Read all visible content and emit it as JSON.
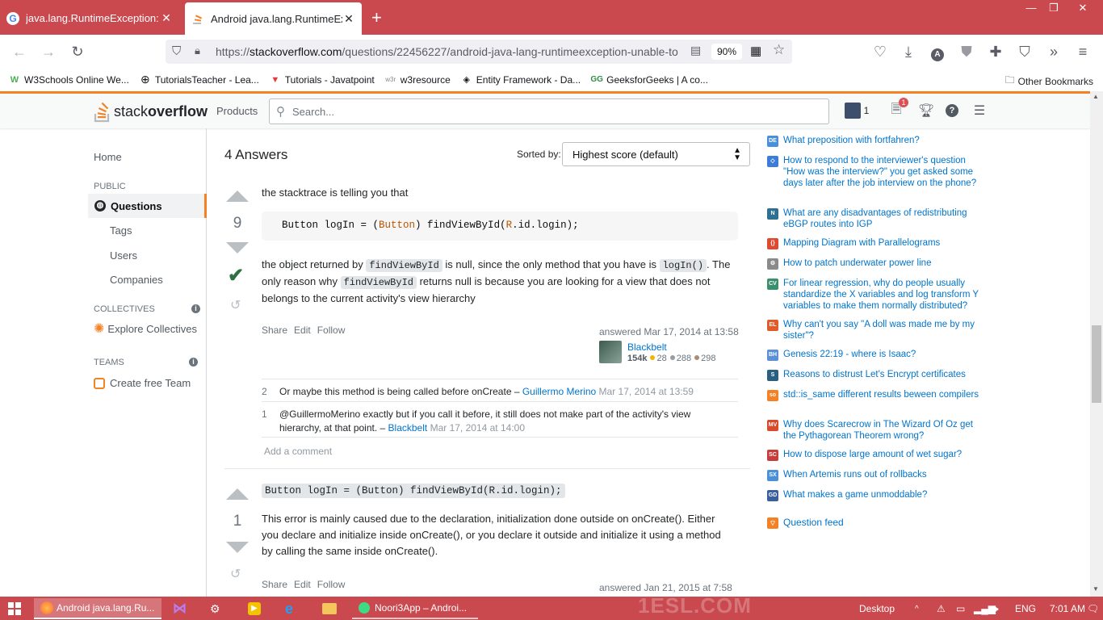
{
  "browser": {
    "tabs": [
      {
        "title": "java.lang.RuntimeException: Un",
        "favicon": "G",
        "active": false
      },
      {
        "title": "Android java.lang.RuntimeExcep",
        "favicon": "so",
        "active": true
      }
    ],
    "new_tab": "+",
    "window_controls": [
      "—",
      "❐",
      "✕"
    ],
    "url_prefix": "https://",
    "url_domain": "stackoverflow.com",
    "url_path": "/questions/22456227/android-java-lang-runtimeexception-unable-to",
    "zoom": "90%",
    "bookmarks": [
      {
        "label": "W3Schools Online We...",
        "icon": "w3-icon"
      },
      {
        "label": "TutorialsTeacher - Lea...",
        "icon": "globe-icon"
      },
      {
        "label": "Tutorials - Javatpoint",
        "icon": "javatpoint-icon"
      },
      {
        "label": "w3resource",
        "icon": "w3r-icon"
      },
      {
        "label": "Entity Framework - Da...",
        "icon": "ef-icon"
      },
      {
        "label": "GeeksforGeeks | A co...",
        "icon": "gfg-icon"
      }
    ],
    "other_bookmarks": "Other Bookmarks"
  },
  "so_header": {
    "logo_text_1": "stack",
    "logo_text_2": "overflow",
    "products": "Products",
    "search_placeholder": "Search...",
    "rep": "1",
    "inbox_count": "1"
  },
  "leftnav": {
    "home": "Home",
    "public": "PUBLIC",
    "questions": "Questions",
    "tags": "Tags",
    "users": "Users",
    "companies": "Companies",
    "collectives": "COLLECTIVES",
    "explore_collectives": "Explore Collectives",
    "teams": "TEAMS",
    "create_team": "Create free Team"
  },
  "main": {
    "answers_count": "4 Answers",
    "sorted_by": "Sorted by:",
    "sort_value": "Highest score (default)",
    "answer1": {
      "score": "9",
      "intro": "the stacktrace is telling you that",
      "code": {
        "a": "Button logIn = (",
        "b": "Button",
        "c": ") findViewById(",
        "d": "R",
        "e": ".id.login);"
      },
      "body_1": "the object returned by ",
      "code_1": "findViewById",
      "body_2": " is null, since the only method that you have is ",
      "code_2": "logIn()",
      "body_3": ". The only reason why ",
      "code_3": "findViewById",
      "body_4": " returns null is because you are looking for a view that does not belongs to the current activity's view hierarchy",
      "menu": [
        "Share",
        "Edit",
        "Follow"
      ],
      "answered": "answered Mar 17, 2014 at 13:58",
      "user": "Blackbelt",
      "reputation": "154k",
      "gold": "28",
      "silver": "288",
      "bronze": "298",
      "comments": [
        {
          "score": "2",
          "text": "Or maybe this method is being called before onCreate – ",
          "user": "Guillermo Merino",
          "date": "Mar 17, 2014 at 13:59"
        },
        {
          "score": "1",
          "text_1": "@GuillermoMerino exactly but if you call it before, it still does not make part of the activity's view",
          "text_2": "hierarchy, at that point. – ",
          "user": "Blackbelt",
          "date": "Mar 17, 2014 at 14:00"
        }
      ],
      "add_comment": "Add a comment"
    },
    "answer2": {
      "score": "1",
      "code": "Button logIn = (Button) findViewById(R.id.login);",
      "body_1": "This error is mainly caused due to the declaration, initialization done outside on onCreate(). Either",
      "body_2": "you declare and initialize inside onCreate(), or you declare it outside and initialize it using a method",
      "body_3": "by calling the same inside onCreate().",
      "menu": [
        "Share",
        "Edit",
        "Follow"
      ],
      "answered": "answered Jan 21, 2015 at 7:58"
    }
  },
  "hot_network": [
    {
      "text": "What preposition with fortfahren?",
      "icon_color": "#4a90d9",
      "icon_label": "DE"
    },
    {
      "text": "How to respond to the interviewer's question \"How was the interview?\" you get asked some days later after the job interview on the phone?",
      "icon_color": "#3b7dd8",
      "icon_label": "◇"
    },
    {
      "text": "What are any disadvantages of redistributing eBGP routes into IGP",
      "icon_color": "#2f6f8f",
      "icon_label": "N"
    },
    {
      "text": "Mapping Diagram with Parallelograms",
      "icon_color": "#e0492f",
      "icon_label": "{}"
    },
    {
      "text": "How to patch underwater power line",
      "icon_color": "#8a8a8a",
      "icon_label": "⚙"
    },
    {
      "text": "For linear regression, why do people usually standardize the X variables and log transform Y variables to make them normally distributed?",
      "icon_color": "#3a8f6f",
      "icon_label": "CV"
    },
    {
      "text": "Why can't you say \"A doll was made me by my sister\"?",
      "icon_color": "#e05a2a",
      "icon_label": "EL"
    },
    {
      "text": "Genesis 22:19 - where is Isaac?",
      "icon_color": "#5b8fd8",
      "icon_label": "BH"
    },
    {
      "text": "Reasons to distrust Let's Encrypt certificates",
      "icon_color": "#2b5f7f",
      "icon_label": "S"
    },
    {
      "text": "std::is_same different results beween compilers",
      "icon_color": "#f48225",
      "icon_label": "so"
    },
    {
      "text": "Why does Scarecrow in The Wizard Of Oz get the Pythagorean Theorem wrong?",
      "icon_color": "#d84a2a",
      "icon_label": "MV"
    },
    {
      "text": "How to dispose large amount of wet sugar?",
      "icon_color": "#c93c3c",
      "icon_label": "SC"
    },
    {
      "text": "When Artemis runs out of rollbacks",
      "icon_color": "#4a8fd8",
      "icon_label": "SX"
    },
    {
      "text": "What makes a game unmoddable?",
      "icon_color": "#3a5f9f",
      "icon_label": "GD"
    }
  ],
  "question_feed": "Question feed",
  "taskbar": {
    "items": [
      {
        "label": "Android java.lang.Ru...",
        "active": true
      },
      {
        "label": "Noori3App – Androi...",
        "active": false
      }
    ],
    "desktop": "Desktop",
    "lang": "ENG",
    "time": "7:01 AM",
    "watermark": "1ESL.COM"
  },
  "colors": {
    "tab_strip": "#c9494f",
    "so_orange": "#f48225",
    "link_blue": "#0074cc",
    "accepted_green": "#2f6f44"
  }
}
